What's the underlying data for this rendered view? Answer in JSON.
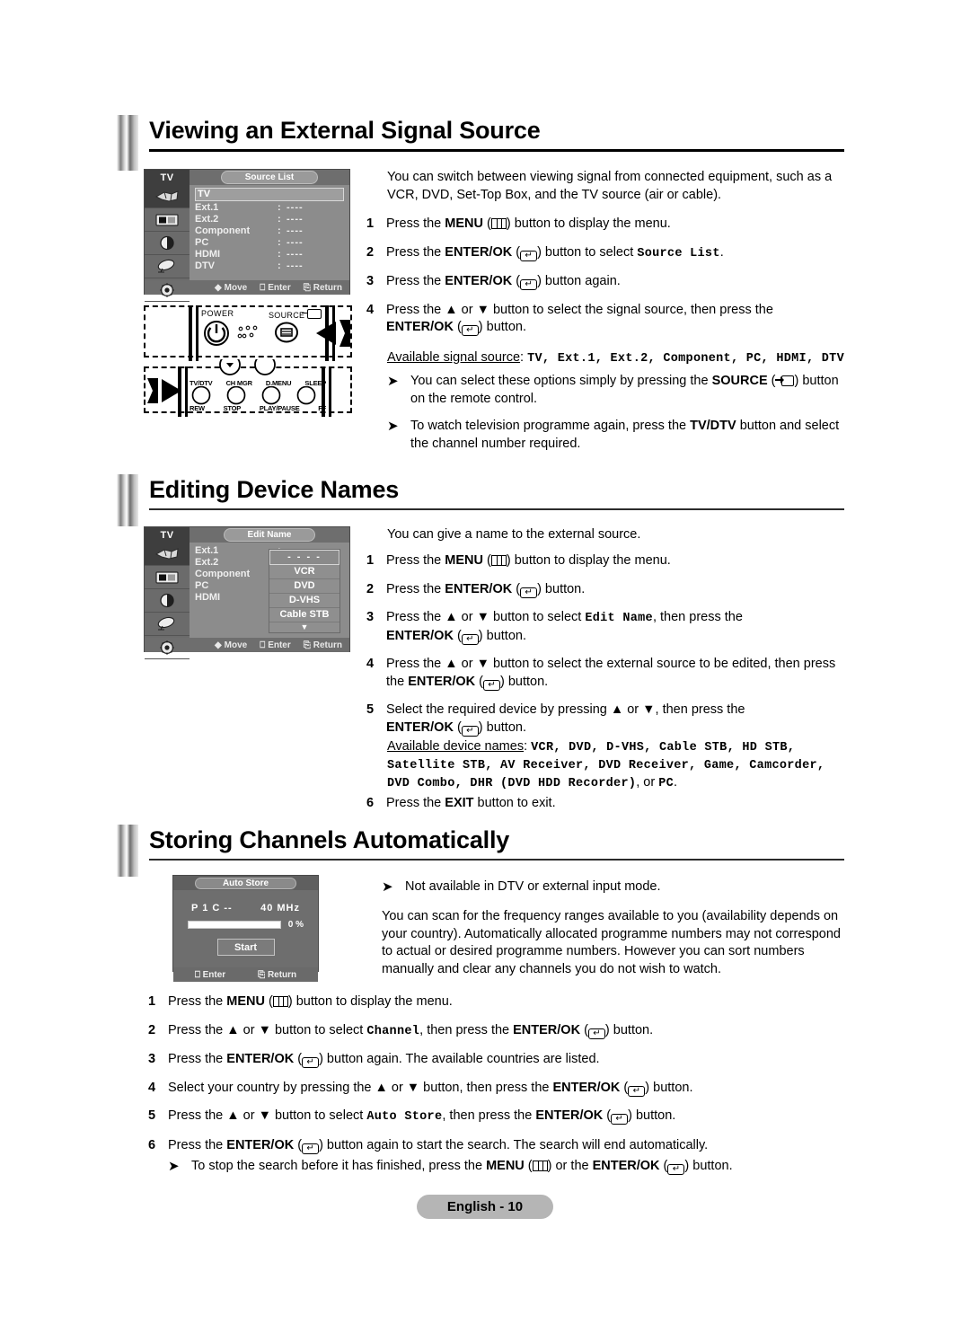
{
  "page": {
    "footer_label": "English - 10"
  },
  "sections": [
    {
      "id": "viewing-external-signal-source",
      "title": "Viewing an External Signal Source",
      "intro": "You can switch between viewing signal from connected equipment, such as a VCR, DVD, Set-Top Box, and the TV source (air or cable).",
      "available_label": "Available signal source",
      "available_values": "TV, Ext.1, Ext.2, Component,  PC, HDMI, DTV"
    },
    {
      "id": "editing-device-names",
      "title": "Editing Device Names",
      "intro": "You can give a name to the external source.",
      "available_label": "Available device names",
      "available_line1": "VCR, DVD, D-VHS, Cable STB, HD STB,",
      "available_line2": "Satellite STB, AV Receiver, DVD Receiver, Game, Camcorder,",
      "available_line3": "DVD Combo, DHR (DVD HDD Recorder)",
      "available_tail": ", or ",
      "available_tail_mono": "PC",
      "available_tail_end": "."
    },
    {
      "id": "storing-channels-automatically",
      "title": "Storing Channels Automatically",
      "note": "Not available in DTV or external input mode.",
      "intro": "You can scan for the frequency ranges available to you (availability depends on your country). Automatically allocated programme numbers may not correspond to actual or desired programme numbers. However you can sort numbers manually and clear any channels you do not wish to watch."
    }
  ],
  "source_list_menu": {
    "tv_label": "TV",
    "title": "Source List",
    "rows": [
      {
        "label": "TV",
        "sep": "",
        "value": "",
        "highlighted": true
      },
      {
        "label": "Ext.1",
        "sep": ":",
        "value": "----",
        "highlighted": false
      },
      {
        "label": "Ext.2",
        "sep": ":",
        "value": "----",
        "highlighted": false
      },
      {
        "label": "Component",
        "sep": ":",
        "value": "----",
        "highlighted": false
      },
      {
        "label": "PC",
        "sep": ":",
        "value": "----",
        "highlighted": false
      },
      {
        "label": "HDMI",
        "sep": ":",
        "value": "----",
        "highlighted": false
      },
      {
        "label": "DTV",
        "sep": ":",
        "value": "----",
        "highlighted": false
      }
    ],
    "footer": {
      "move": "Move",
      "enter": "Enter",
      "return": "Return"
    }
  },
  "edit_name_menu": {
    "tv_label": "TV",
    "title": "Edit Name",
    "rows": [
      {
        "label": "Ext.1",
        "sep": ":"
      },
      {
        "label": "Ext.2",
        "sep": ":"
      },
      {
        "label": "Component",
        "sep": ":"
      },
      {
        "label": "PC",
        "sep": ":"
      },
      {
        "label": "HDMI",
        "sep": ":"
      }
    ],
    "dropdown": [
      "- - - -",
      "VCR",
      "DVD",
      "D-VHS",
      "Cable STB"
    ],
    "dropdown_more": "▼",
    "footer": {
      "move": "Move",
      "enter": "Enter",
      "return": "Return"
    }
  },
  "auto_store_dialog": {
    "title": "Auto Store",
    "programme": "P  1   C --",
    "frequency": "40 MHz",
    "progress_percent": "0 %",
    "start_label": "Start",
    "footer": {
      "enter": "Enter",
      "return": "Return"
    }
  },
  "remote_top": {
    "power_label": "POWER",
    "source_label": "SOURCE"
  },
  "remote_bottom": {
    "top_labels": [
      "TV/DTV",
      "CH MGR",
      "D.MENU",
      "SLEEP"
    ],
    "bottom_labels": [
      "REW",
      "STOP",
      "PLAY/PAUSE",
      "FF"
    ]
  },
  "steps_source": [
    {
      "num": "1",
      "pre": "Press the ",
      "bold": "MENU",
      "key": "menu",
      "post": " button to display the menu."
    },
    {
      "num": "2",
      "pre": "Press the ",
      "bold": "ENTER/OK",
      "key": "enter",
      "post": " button to select ",
      "mono": "Source List",
      "tail": "."
    },
    {
      "num": "3",
      "pre": "Press the ",
      "bold": "ENTER/OK",
      "key": "enter",
      "post": " button again."
    },
    {
      "num": "4",
      "pre": "Press the ▲ or ▼ button to select the signal source, then press the ",
      "bold": "ENTER/OK",
      "key": "enter",
      "post": " button.",
      "wrap": true
    }
  ],
  "bullets_source": [
    {
      "pre": "You can select these options simply by pressing the ",
      "bold": "SOURCE",
      "key": "source",
      "post": " button on the remote control."
    },
    {
      "pre": "To watch television programme again, press the ",
      "bold": "TV/DTV",
      "post": " button and select the channel number required."
    }
  ],
  "steps_edit": [
    {
      "num": "1",
      "pre": "Press the ",
      "bold": "MENU",
      "key": "menu",
      "post": " button to display the menu."
    },
    {
      "num": "2",
      "pre": "Press the ",
      "bold": "ENTER/OK",
      "key": "enter",
      "post": " button."
    },
    {
      "num": "3",
      "pre": "Press the ▲ or ▼ button to select ",
      "mono": "Edit Name",
      "mid": ", then press the ",
      "bold": "ENTER/OK",
      "key": "enter",
      "post": " button."
    },
    {
      "num": "4",
      "pre": "Press the ▲ or ▼ button to select the external source to be edited, then press the ",
      "bold": "ENTER/OK",
      "key": "enter",
      "post": " button."
    },
    {
      "num": "5",
      "pre": "Select the required device by pressing ▲ or ▼, then press the ",
      "bold": "ENTER/OK",
      "key": "enter",
      "post": " button."
    },
    {
      "num": "6",
      "pre": "Press the ",
      "bold": "EXIT",
      "post": " button to exit."
    }
  ],
  "steps_store": [
    {
      "num": "1",
      "pre": "Press the ",
      "bold": "MENU",
      "key": "menu",
      "post": " button to display the menu."
    },
    {
      "num": "2",
      "pre": "Press the ▲ or ▼ button to select ",
      "mono": "Channel",
      "mid": ", then press the ",
      "bold": "ENTER/OK",
      "key": "enter",
      "post": " button."
    },
    {
      "num": "3",
      "pre": "Press the ",
      "bold": "ENTER/OK",
      "key": "enter",
      "post": " button again. The available countries are listed."
    },
    {
      "num": "4",
      "pre": "Select your country by pressing the ▲ or ▼ button, then press the ",
      "bold": "ENTER/OK",
      "key": "enter",
      "post": " button."
    },
    {
      "num": "5",
      "pre": "Press the ▲ or ▼ button to select ",
      "mono": "Auto Store",
      "mid": ", then press the ",
      "bold": "ENTER/OK",
      "key": "enter",
      "post": " button."
    },
    {
      "num": "6",
      "pre": "Press the ",
      "bold": "ENTER/OK",
      "key": "enter",
      "post": " button again to start the search. The search will end automatically."
    }
  ],
  "store_final_bullet": {
    "pre": "To stop the search before it has finished, press the ",
    "bold1": "MENU",
    "key1": "menu",
    "mid": " or the ",
    "bold2": "ENTER/OK",
    "key2": "enter",
    "post": " button."
  }
}
